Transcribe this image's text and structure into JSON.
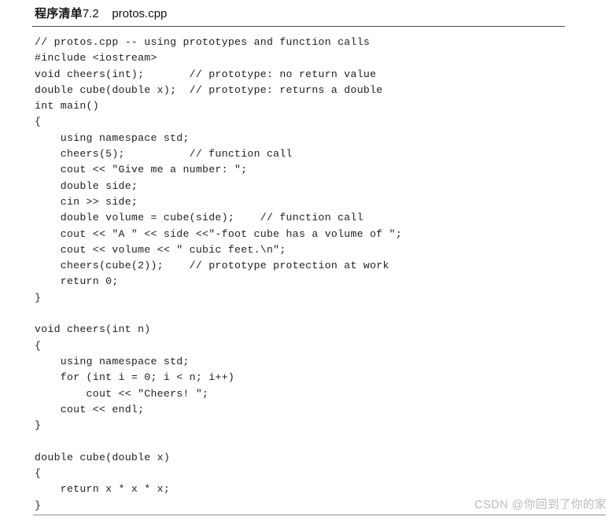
{
  "page": {
    "background_color": "#ffffff",
    "text_color": "#1e1e1e"
  },
  "caption": {
    "label": "程序清单",
    "number": "7.2",
    "filename": "protos.cpp",
    "separator": "    "
  },
  "rules": {
    "top_color": "#4a4a4a",
    "bottom_color": "#8e8e8e"
  },
  "listing": {
    "language": "cpp",
    "lines": [
      "// protos.cpp -- using prototypes and function calls",
      "#include <iostream>",
      "void cheers(int);       // prototype: no return value",
      "double cube(double x);  // prototype: returns a double",
      "int main()",
      "{",
      "    using namespace std;",
      "    cheers(5);          // function call",
      "    cout << \"Give me a number: \";",
      "    double side;",
      "    cin >> side;",
      "    double volume = cube(side);    // function call",
      "    cout << \"A \" << side <<\"-foot cube has a volume of \";",
      "    cout << volume << \" cubic feet.\\n\";",
      "    cheers(cube(2));    // prototype protection at work",
      "    return 0;",
      "}",
      "",
      "void cheers(int n)",
      "{",
      "    using namespace std;",
      "    for (int i = 0; i < n; i++)",
      "        cout << \"Cheers! \";",
      "    cout << endl;",
      "}",
      "",
      "double cube(double x)",
      "{",
      "    return x * x * x;",
      "}"
    ]
  },
  "watermark": {
    "text": "CSDN @你回到了你的家",
    "color": "#b9b9b9"
  }
}
